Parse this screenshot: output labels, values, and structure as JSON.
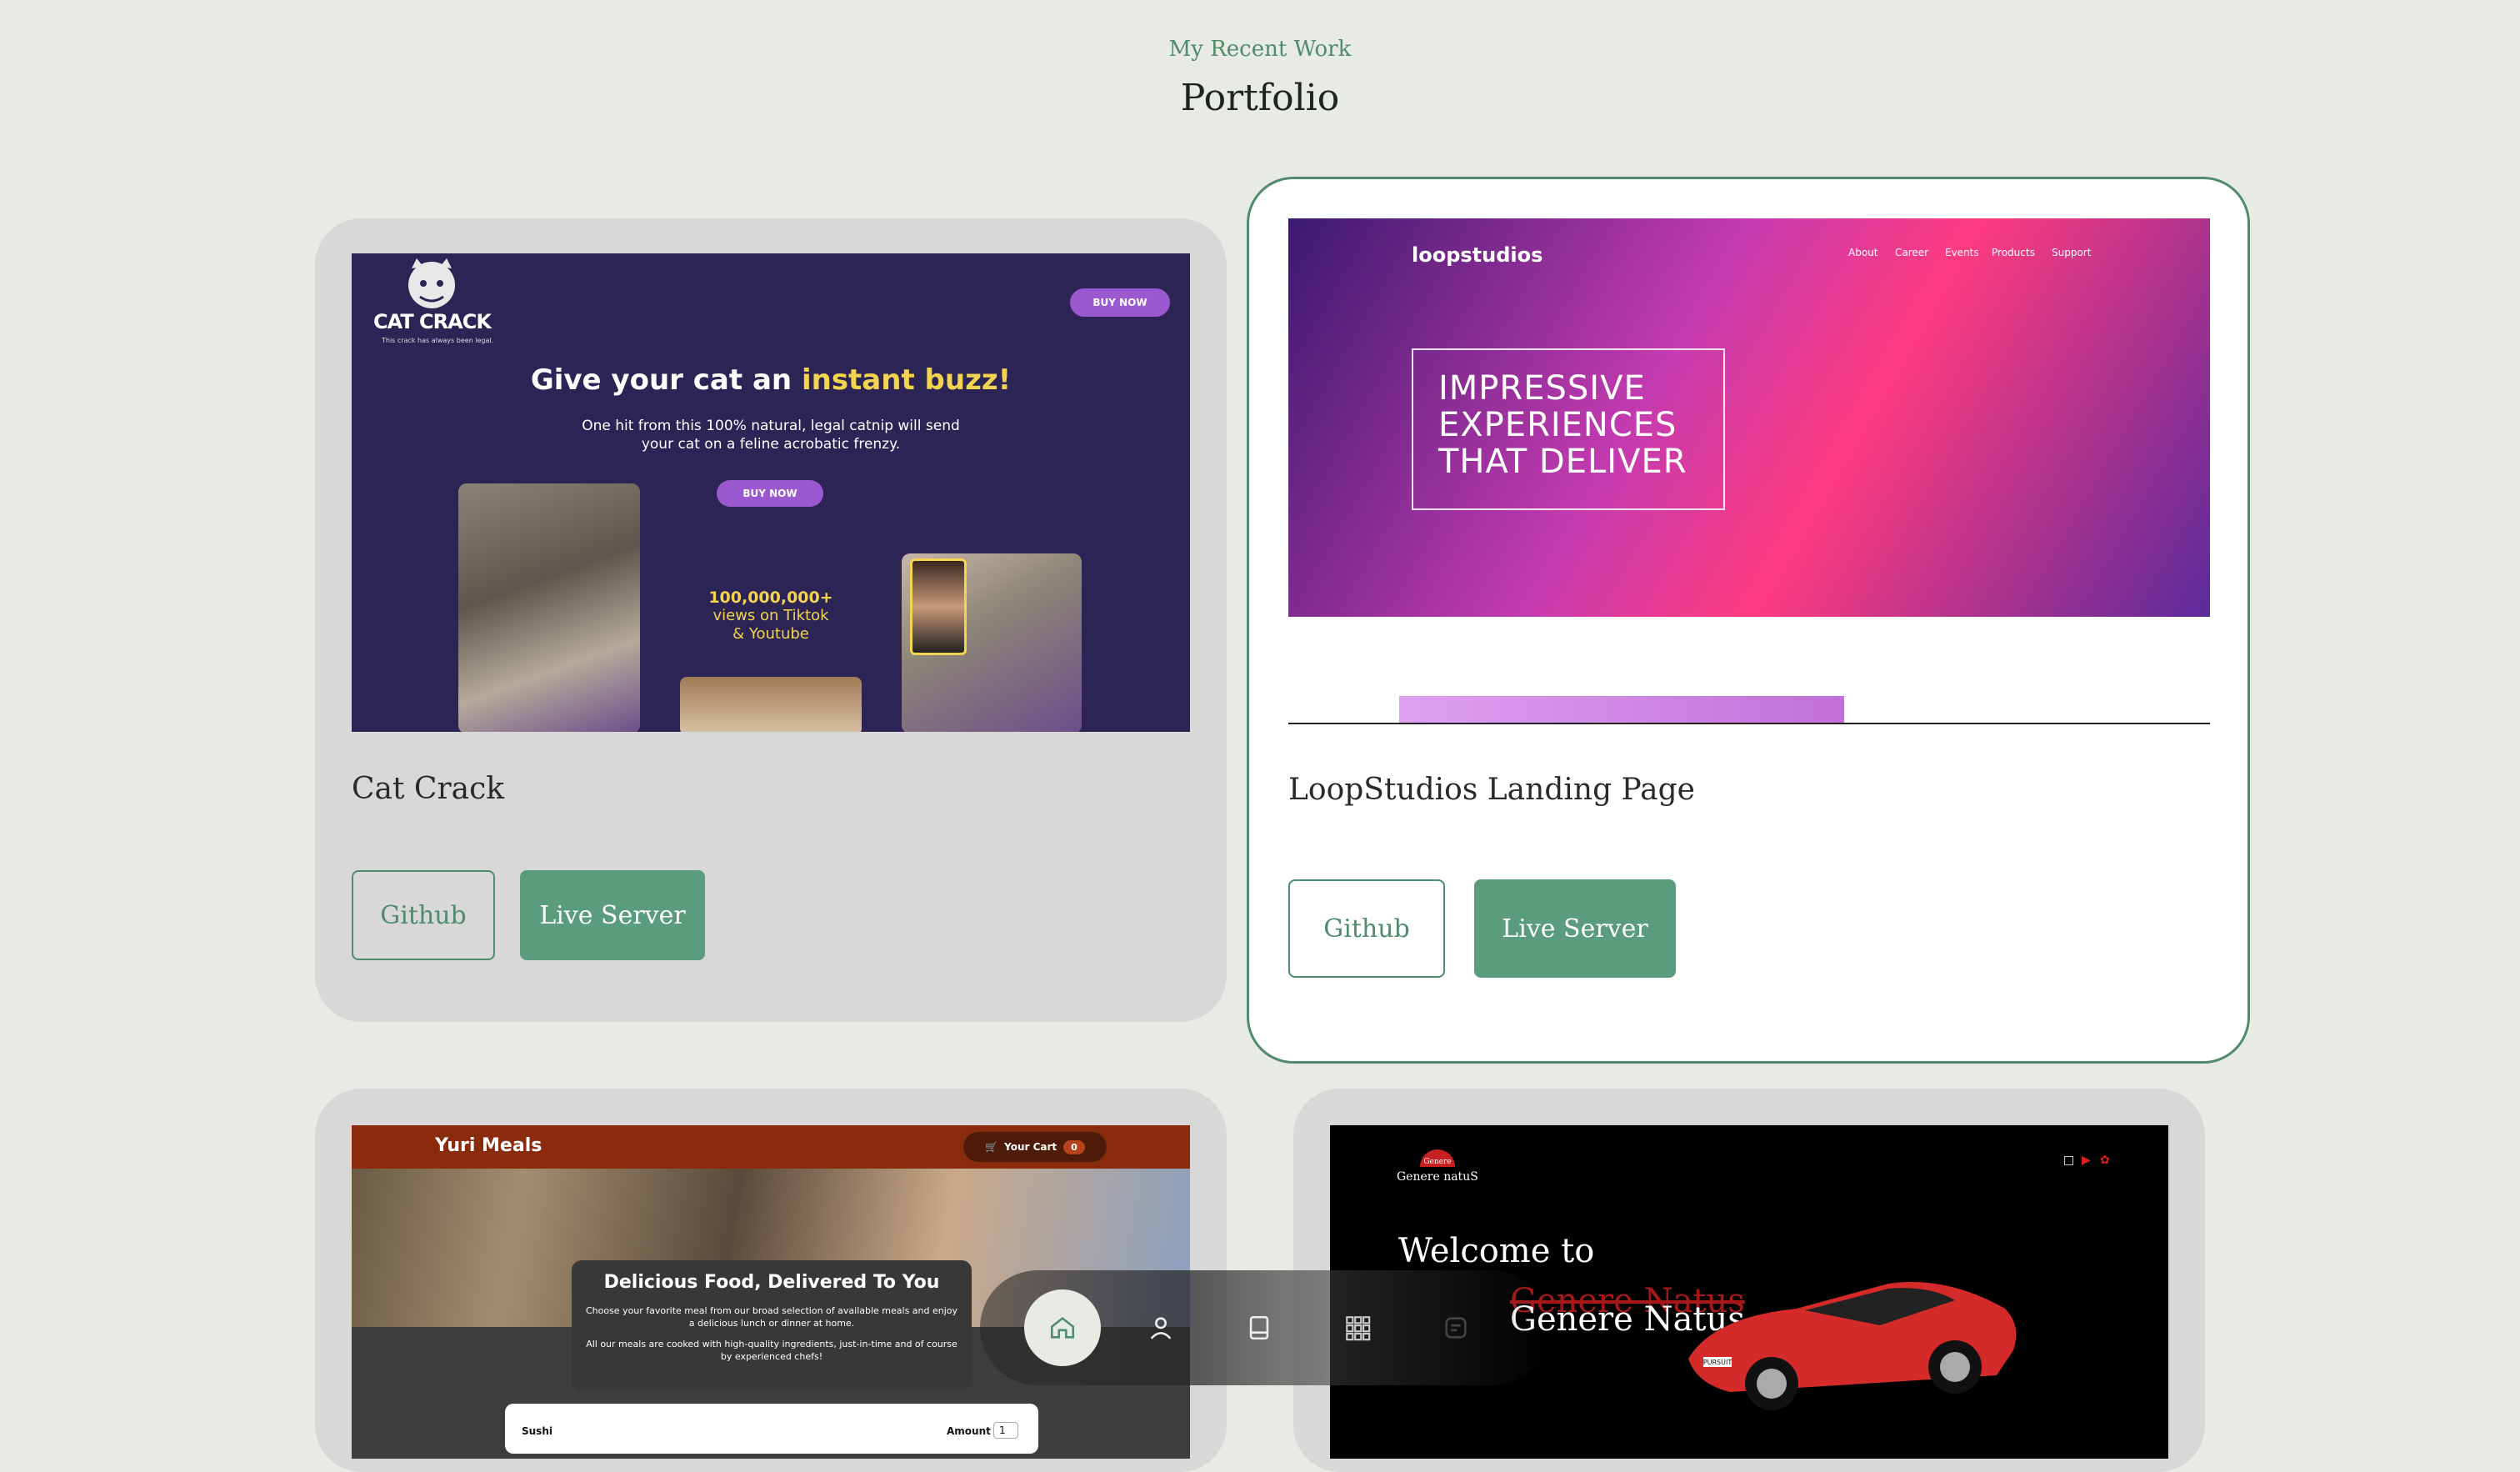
{
  "header": {
    "eyebrow": "My Recent Work",
    "title": "Portfolio"
  },
  "projects": [
    {
      "name": "Cat Crack",
      "github": "Github",
      "live": "Live Server",
      "preview": {
        "logo": "CAT CRACK",
        "tagline": "This crack has always been legal.",
        "buy": "BUY NOW",
        "headline": "Give your cat an",
        "headline_hl": "instant buzz!",
        "sub1": "One hit from this 100% natural, legal catnip will send",
        "sub2": "your cat on a feline acrobatic frenzy.",
        "stat": "100,000,000+",
        "stat_line1": "views on Tiktok",
        "stat_line2": "& Youtube"
      }
    },
    {
      "name": "LoopStudios Landing Page",
      "github": "Github",
      "live": "Live Server",
      "preview": {
        "brand": "loopstudios",
        "nav": [
          "About",
          "Career",
          "Events",
          "Products",
          "Support"
        ],
        "hero_l1": "IMPRESSIVE",
        "hero_l2": "EXPERIENCES",
        "hero_l3": "THAT DELIVER"
      }
    },
    {
      "preview": {
        "brand": "Yuri Meals",
        "cart": "Your Cart",
        "cart_count": "0",
        "panel_title": "Delicious Food, Delivered To You",
        "panel_p1": "Choose your favorite meal from our broad selection of available meals and enjoy a delicious lunch or dinner at home.",
        "panel_p2": "All our meals are cooked with high-quality ingredients, just-in-time and of course by experienced chefs!",
        "item": "Sushi",
        "amount_label": "Amount",
        "amount_value": "1"
      }
    },
    {
      "preview": {
        "logo_l1": "Genere",
        "logo_l2": "Genere natuS",
        "welcome": "Welcome to",
        "name_red": "Genere Natus",
        "name": "Genere Natus",
        "plate": "PURSUIT"
      }
    }
  ],
  "dock": {
    "items": [
      {
        "icon": "home-icon",
        "active": true
      },
      {
        "icon": "user-icon",
        "active": false
      },
      {
        "icon": "book-icon",
        "active": false
      },
      {
        "icon": "grid-icon",
        "active": false
      },
      {
        "icon": "message-icon",
        "active": false
      }
    ]
  },
  "colors": {
    "accent": "#4f8b6d",
    "button_fill": "#5a9c7d",
    "page_bg": "#e8eae4",
    "card_bg": "#d8d8d8"
  }
}
